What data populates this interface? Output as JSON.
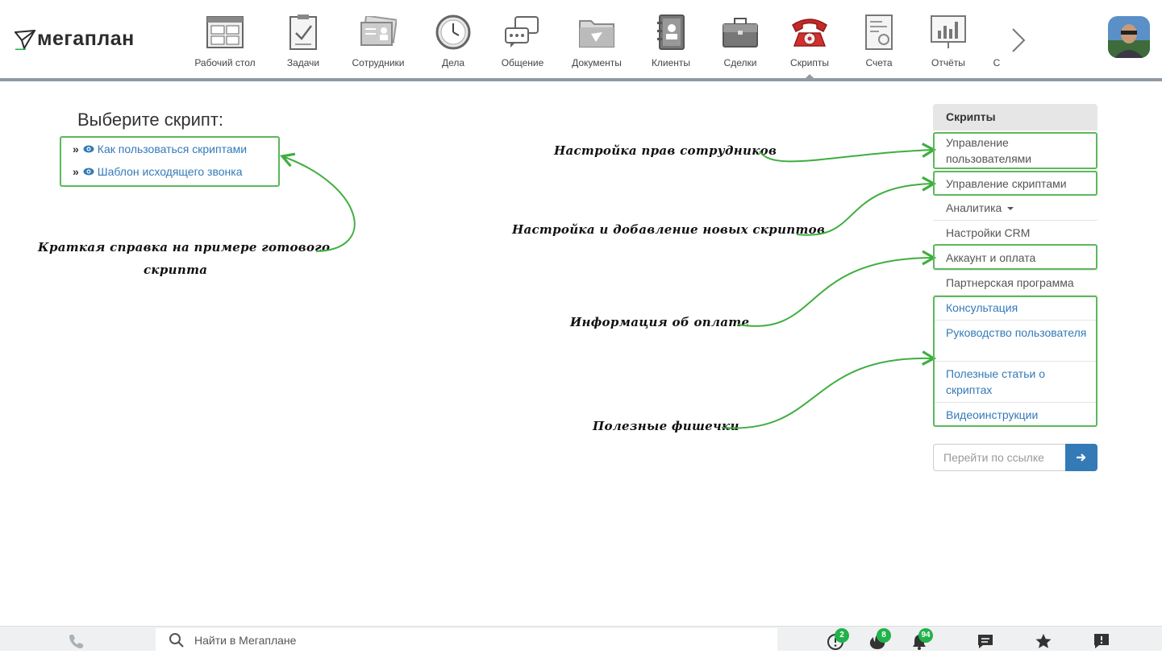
{
  "app": {
    "logo_text": "мегаплан"
  },
  "nav": {
    "items": [
      {
        "label": "Рабочий стол",
        "icon": "dashboard-icon"
      },
      {
        "label": "Задачи",
        "icon": "tasks-icon"
      },
      {
        "label": "Сотрудники",
        "icon": "employees-icon"
      },
      {
        "label": "Дела",
        "icon": "clock-icon"
      },
      {
        "label": "Общение",
        "icon": "chat-icon"
      },
      {
        "label": "Документы",
        "icon": "folder-icon"
      },
      {
        "label": "Клиенты",
        "icon": "contacts-book-icon"
      },
      {
        "label": "Сделки",
        "icon": "briefcase-icon"
      },
      {
        "label": "Скрипты",
        "icon": "telephone-icon",
        "active": true
      },
      {
        "label": "Счета",
        "icon": "invoice-icon"
      },
      {
        "label": "Отчёты",
        "icon": "report-board-icon"
      },
      {
        "label": "С",
        "icon": "partial-item"
      }
    ],
    "next_icon": "chevron-right-icon"
  },
  "main": {
    "title": "Выберите скрипт:",
    "scripts": [
      {
        "label": "Как пользоваться скриптами"
      },
      {
        "label": "Шаблон исходящего звонка"
      }
    ]
  },
  "annotations": {
    "rights": "Настройка прав сотрудников",
    "add_scripts": "Настройка и добавление новых скриптов",
    "payment": "Информация об оплате",
    "tips": "Полезные фишечки",
    "help_line1": "Краткая справка на примере готового",
    "help_line2": "скрипта"
  },
  "sidebar": {
    "title": "Скрипты",
    "items": [
      {
        "label": "Управление пользователями"
      },
      {
        "label": "Управление скриптами"
      },
      {
        "label": "Аналитика"
      },
      {
        "label": "Настройки CRM"
      },
      {
        "label": "Аккаунт и оплата"
      },
      {
        "label": "Партнерская программа"
      },
      {
        "label": "Консультация"
      },
      {
        "label": "Руководство пользователя"
      },
      {
        "label": "Полезные статьи о скриптах"
      },
      {
        "label": "Видеоинструкции"
      }
    ]
  },
  "goto": {
    "placeholder": "Перейти по ссылке"
  },
  "footer": {
    "search_placeholder": "Найти в Мегаплане",
    "badges": {
      "alerts": "2",
      "hot": "8",
      "notifications": "94"
    }
  },
  "colors": {
    "accent": "#337ab7",
    "highlight": "#5cb85c",
    "badge": "#21b24b",
    "nav_line": "#8f9aa3"
  }
}
